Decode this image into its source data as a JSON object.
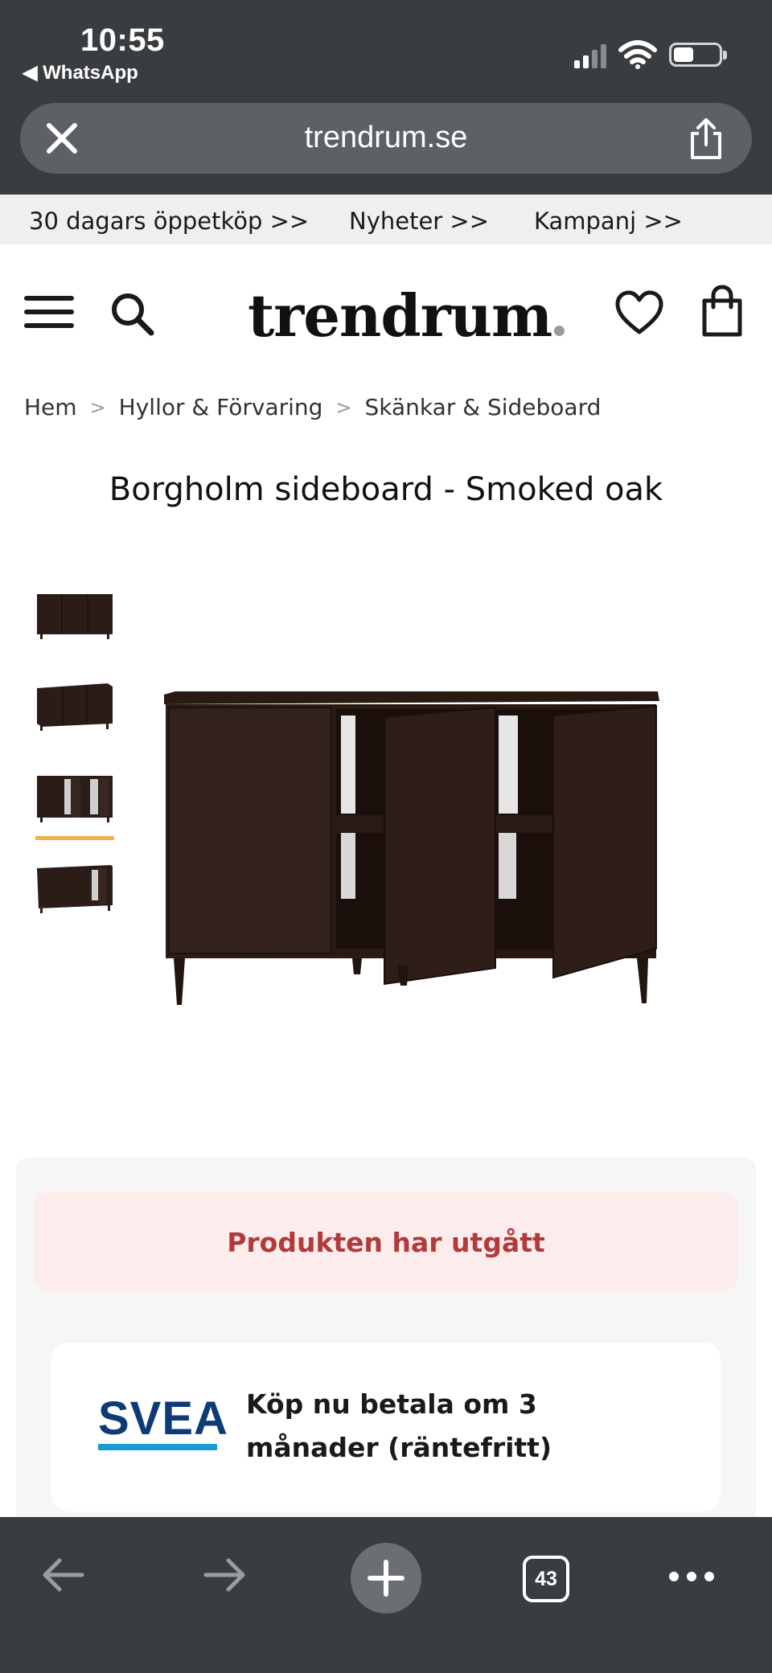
{
  "status_bar": {
    "time": "10:55",
    "back_app": "◀ WhatsApp"
  },
  "browser": {
    "url": "trendrum.se",
    "tab_count": "43"
  },
  "promo_links": [
    "30 dagars öppetköp >>",
    "Nyheter >>",
    "Kampanj >>"
  ],
  "header": {
    "logo_text": "trendrum"
  },
  "breadcrumb": {
    "items": [
      "Hem",
      "Hyllor & Förvaring",
      "Skänkar & Sideboard"
    ],
    "separator": ">"
  },
  "product": {
    "title": "Borgholm sideboard - Smoked oak",
    "thumbnail_count": 4,
    "active_thumbnail": 3,
    "status_message": "Produkten har utgått",
    "payment": {
      "provider_logo": "SVEA",
      "text": "Köp nu betala om 3 månader (räntefritt)"
    }
  },
  "colors": {
    "chrome": "#3a3d40",
    "urlbar": "#5d6165",
    "promo_bg": "#efefef",
    "discontinued_bg": "#fcecec",
    "discontinued_text": "#b23a3a",
    "thumb_indicator": "#f0b24a",
    "svea_blue": "#0e3b75",
    "svea_accent": "#1a9bd7",
    "wood": "#2b1c17"
  },
  "icons": {
    "close": "close-icon",
    "share": "share-icon",
    "menu": "hamburger-menu-icon",
    "search": "search-icon",
    "wishlist": "heart-icon",
    "cart": "shopping-bag-icon",
    "back": "arrow-left-icon",
    "forward": "arrow-right-icon",
    "new_tab": "plus-icon",
    "more": "more-dots-icon"
  }
}
